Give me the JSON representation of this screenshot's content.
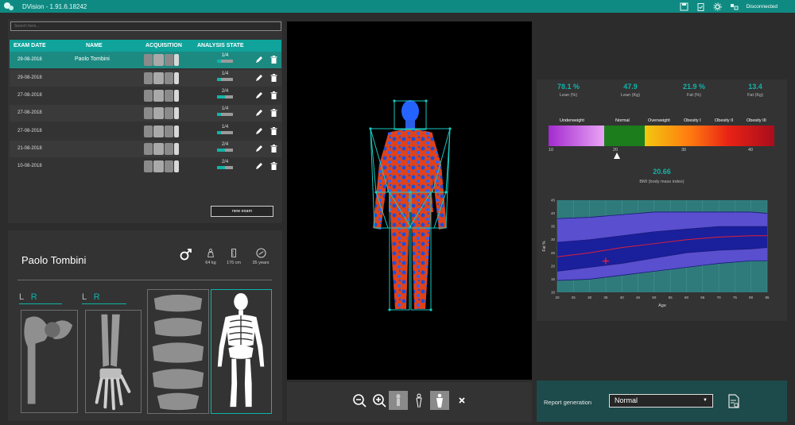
{
  "app": {
    "title": "DVision - 1.91.6.18242",
    "connection_status": "Disconnected"
  },
  "exam_list": {
    "search_placeholder": "Search here...",
    "columns": [
      "EXAM DATE",
      "NAME",
      "ACQUISITION",
      "ANALYSIS STATE"
    ],
    "rows": [
      {
        "date": "29-08-2018",
        "name": "Paolo Tombini",
        "state": "1/4",
        "done": 1,
        "selected": true
      },
      {
        "date": "29-08-2018",
        "name": "",
        "state": "1/4",
        "done": 1
      },
      {
        "date": "27-08-2018",
        "name": "",
        "state": "2/4",
        "done": 2
      },
      {
        "date": "27-08-2018",
        "name": "",
        "state": "1/4",
        "done": 1
      },
      {
        "date": "27-08-2018",
        "name": "",
        "state": "1/4",
        "done": 1
      },
      {
        "date": "21-08-2018",
        "name": "",
        "state": "2/4",
        "done": 2
      },
      {
        "date": "10-08-2018",
        "name": "",
        "state": "2/4",
        "done": 2
      }
    ],
    "new_exam_label": "new exam"
  },
  "patient": {
    "name": "Paolo Tombini",
    "weight": "64 kg",
    "height": "176 cm",
    "age": "35 years",
    "side_left": "L",
    "side_right": "R"
  },
  "results": {
    "metrics": [
      {
        "value": "78.1 %",
        "label": "Lean (%)"
      },
      {
        "value": "47.9",
        "label": "Lean (Kg)"
      },
      {
        "value": "21.9 %",
        "label": "Fat (%)"
      },
      {
        "value": "13.4",
        "label": "Fat (Kg)"
      }
    ],
    "bmi_categories": [
      "Underweight",
      "Normal",
      "Overweight",
      "Obesity I",
      "Obesity II",
      "Obesity III"
    ],
    "bmi_ticks": [
      "10",
      "20",
      "30",
      "40"
    ],
    "bmi_value": "20.66",
    "bmi_label": "BMI (body mass index)",
    "bmi_numeric": 20.66
  },
  "chart_data": {
    "type": "area",
    "ylabel": "Fat %",
    "xlabel": "Age",
    "x_ticks": [
      "20",
      "25",
      "30",
      "35",
      "40",
      "45",
      "50",
      "55",
      "60",
      "65",
      "70",
      "75",
      "80",
      "85"
    ],
    "y_ticks": [
      "10",
      "15",
      "20",
      "25",
      "30",
      "35",
      "40",
      "45"
    ],
    "xlim": [
      20,
      85
    ],
    "ylim": [
      10,
      45
    ],
    "x": [
      20,
      30,
      40,
      50,
      60,
      70,
      80,
      85
    ],
    "series": [
      {
        "values": [
          38,
          38.5,
          39.5,
          40.5,
          40.5,
          40.5,
          40.5,
          40
        ]
      },
      {
        "values": [
          29,
          30,
          31.5,
          33,
          34,
          35,
          35,
          35
        ]
      },
      {
        "values": [
          23.5,
          25,
          27,
          28.5,
          30,
          31,
          31.5,
          31.5
        ]
      },
      {
        "values": [
          18,
          19.5,
          21,
          23,
          25,
          26,
          26.5,
          27
        ]
      },
      {
        "values": [
          14.5,
          15,
          16.5,
          18,
          19.5,
          21,
          22,
          22
        ]
      }
    ],
    "points": [
      {
        "x": 35,
        "y": 21.9
      }
    ]
  },
  "report": {
    "label": "Report generation",
    "selected": "Normal"
  }
}
